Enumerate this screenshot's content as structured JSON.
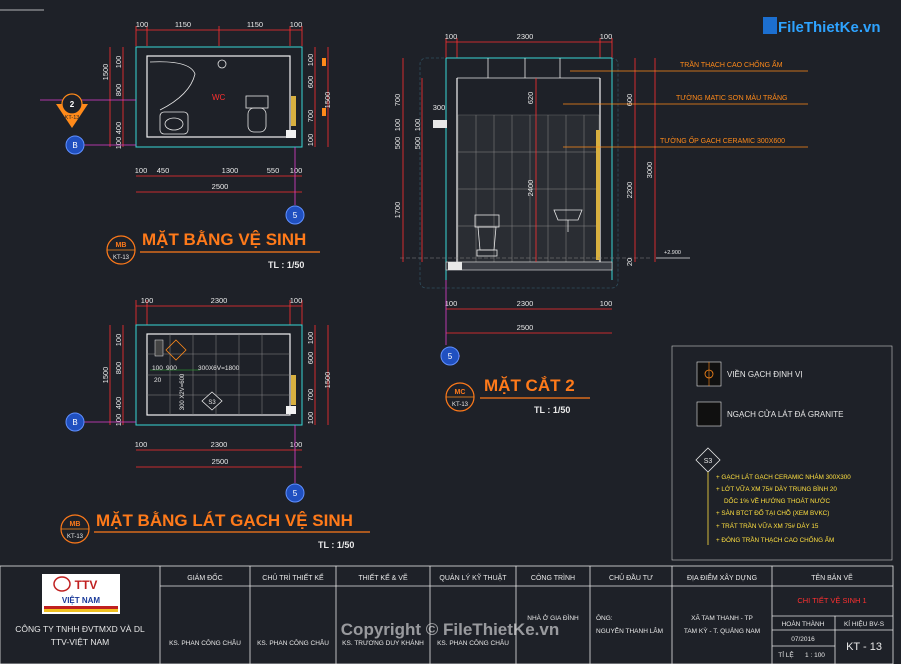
{
  "logo": {
    "name": "FileThietKe.vn"
  },
  "watermark": "Copyright © FileThietKe.vn",
  "plan1": {
    "title": "MẶT BẰNG VỆ SINH",
    "scale": "TL : 1/50",
    "tag_top": "MB",
    "tag_bot": "KT-13",
    "sec_num": "2",
    "sec_ref": "KT-13",
    "axis_b": "B",
    "axis_5": "5",
    "room_label": "WC",
    "top_dims": [
      "100",
      "1150",
      "1150",
      "100"
    ],
    "bottom_dims1": [
      "100",
      "450",
      "1300",
      "550",
      "100"
    ],
    "bottom_total": "2500",
    "left_dims": [
      "100",
      "800",
      "400",
      "100"
    ],
    "left_total": "1500",
    "right_dims": [
      "100",
      "600",
      "700",
      "100"
    ],
    "right_total": "1500"
  },
  "plan2": {
    "title": "MẶT BẰNG LÁT GẠCH VỆ SINH",
    "scale": "TL : 1/50",
    "tag_top": "MB",
    "tag_bot": "KT-13",
    "axis_b": "B",
    "axis_5": "5",
    "top_dims": [
      "100",
      "2300",
      "100"
    ],
    "tile_label": "300X6V=1800",
    "v_label": "300 X2V=600",
    "note_a": "100",
    "note_b": "900",
    "note_c": "20",
    "s3": "S3",
    "bottom_dims": [
      "100",
      "2300",
      "100"
    ],
    "bottom_total": "2500",
    "left_dims": [
      "100",
      "800",
      "400",
      "100"
    ],
    "left_total": "1500",
    "right_dims": [
      "100",
      "600",
      "700",
      "100"
    ],
    "right_total": "1500"
  },
  "section": {
    "title": "MẶT CẮT 2",
    "scale": "TL : 1/50",
    "tag_top": "MC",
    "tag_bot": "KT-13",
    "axis_5": "5",
    "top_dims": [
      "100",
      "2300",
      "100"
    ],
    "bottom_dims": [
      "100",
      "2300",
      "100"
    ],
    "bottom_total": "2500",
    "left_dims": [
      "700",
      "100",
      "500",
      "1700"
    ],
    "left_small": "300",
    "inner_dims": [
      "620",
      "2400"
    ],
    "right_dims": [
      "600",
      "2200",
      "3000"
    ],
    "right_small": "20",
    "level": "+2.900",
    "callouts": [
      "TRẦN THẠCH CAO CHỐNG ẨM",
      "TƯỜNG MATIC SƠN MÀU TRẮNG",
      "TƯỜNG ỐP GẠCH CERAMIC 300X600"
    ]
  },
  "legend": {
    "item1": "VIỀN GẠCH ĐỊNH VỊ",
    "item2": "NGẠCH CỬA LÁT ĐÁ GRANITE",
    "tag": "S3",
    "notes": [
      "+ GẠCH LÁT GẠCH CERAMIC NHÁM 300X300",
      "+ LỚT VỮA XM 75# DÀY TRUNG BÌNH 20",
      "DỐC 1% VỀ HƯỚNG THOÁT NƯỚC",
      "+ SÀN BTCT ĐỔ TẠI CHỖ (XEM BVKC)",
      "+ TRÁT TRẦN VỮA XM 75# DÀY 15",
      "+ ĐÓNG TRẦN THẠCH CAO CHỐNG ẨM"
    ]
  },
  "titleblock": {
    "company_line1": "CÔNG TY TNHH ĐVTMXD VÀ DL",
    "company_line2": "TTV-VIỆT NAM",
    "logo_text": "TTV",
    "logo_sub": "VIỆT NAM",
    "headers": [
      "GIÁM ĐỐC",
      "CHỦ TRÌ THIẾT KẾ",
      "THIẾT KẾ & VẼ",
      "QUẢN LÝ KỸ THUẬT",
      "CÔNG TRÌNH",
      "CHỦ ĐẦU TƯ",
      "ĐỊA ĐIỂM XÂY DỰNG",
      "TÊN BẢN VẼ"
    ],
    "names": [
      "KS. PHAN CÔNG CHÂU",
      "KS. PHAN CÔNG CHÂU",
      "KS. TRƯƠNG DUY KHÁNH",
      "KS. PHAN CÔNG CHÂU"
    ],
    "project": "NHÀ Ở GIA ĐÌNH",
    "owner1": "ÔNG:",
    "owner2": "NGUYỄN THANH LÂM",
    "site1": "XÃ TAM THANH - TP",
    "site2": "TAM KỲ - T. QUẢNG NAM",
    "drawing_name": "CHI TIẾT VỆ SINH 1",
    "done_label": "HOÀN THÀNH",
    "done_val": "07/2016",
    "sheet_label": "KÍ HIỆU BV-S",
    "sheet_val": "KT - 13",
    "ratio_label": "TỈ LỆ",
    "ratio_val": "1 : 100"
  }
}
